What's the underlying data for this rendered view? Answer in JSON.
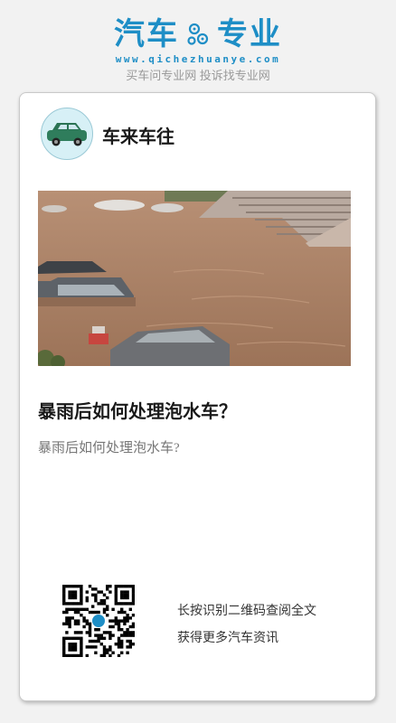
{
  "header": {
    "logo_left": "汽车",
    "logo_right": "专业",
    "logo_url": "www.qichezhuanye.com",
    "tagline": "买车问专业网 投诉找专业网",
    "brand_color": "#1e8ec6"
  },
  "card": {
    "author": "车来车往",
    "title": "暴雨后如何处理泡水车？",
    "summary": "暴雨后如何处理泡水车?",
    "cta_line1": "长按识别二维码查阅全文",
    "cta_line2": "获得更多汽车资讯"
  }
}
